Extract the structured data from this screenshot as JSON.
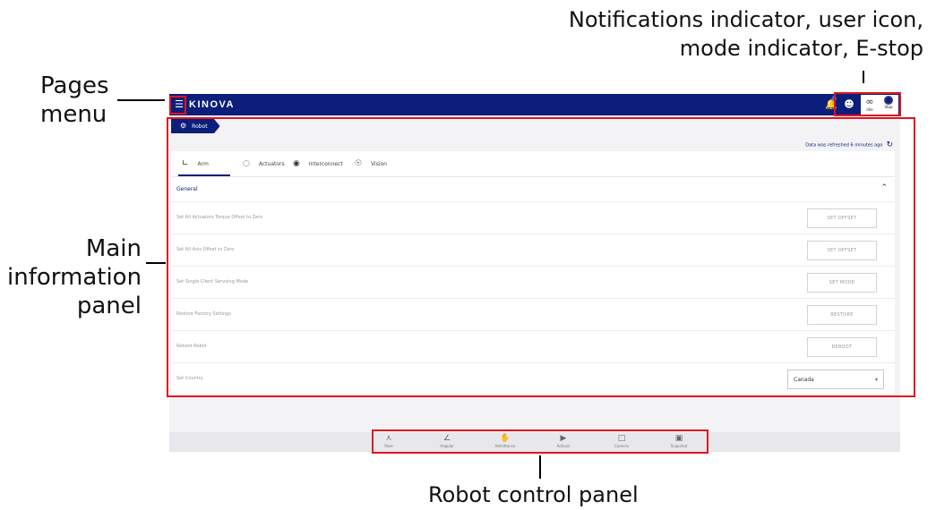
{
  "annotations": {
    "top_line1": "Notifications indicator, user icon,",
    "top_line2": "mode indicator, E-stop",
    "pages_line1": "Pages",
    "pages_line2": "menu",
    "main_line1": "Main",
    "main_line2": "information",
    "main_line3": "panel",
    "bottom": "Robot control panel"
  },
  "header": {
    "logo": "KINOVA",
    "notification_count": "1",
    "mode_label": "Idle",
    "estop_label": "Stop"
  },
  "breadcrumb": {
    "label": "Robot"
  },
  "refresh_text": "Data was refreshed 6 minutes ago",
  "tabs": [
    {
      "label": "Arm",
      "icon": "arm-icon",
      "active": true
    },
    {
      "label": "Actuators",
      "icon": "actuators-icon"
    },
    {
      "label": "Interconnect",
      "icon": "interconnect-icon"
    },
    {
      "label": "Vision",
      "icon": "vision-icon"
    }
  ],
  "section": {
    "title": "General"
  },
  "rows": [
    {
      "label": "Set All Actuators Torque Offset to Zero",
      "button": "SET OFFSET"
    },
    {
      "label": "Set All Axis Offset to Zero",
      "button": "SET OFFSET"
    },
    {
      "label": "Set Single Client Servoing Mode",
      "button": "SET MODE"
    },
    {
      "label": "Restore Factory Settings",
      "button": "RESTORE"
    },
    {
      "label": "Reboot Robot",
      "button": "REBOOT"
    },
    {
      "label": "Set Country",
      "select_value": "Canada"
    }
  ],
  "controls": [
    {
      "label": "Pose",
      "icon": "pose-icon"
    },
    {
      "label": "Angular",
      "icon": "angular-icon"
    },
    {
      "label": "Admittance",
      "icon": "admittance-icon"
    },
    {
      "label": "Actions",
      "icon": "actions-icon"
    },
    {
      "label": "Camera",
      "icon": "camera-icon"
    },
    {
      "label": "Snapshot",
      "icon": "snapshot-icon"
    }
  ],
  "colors": {
    "brand": "#0b1f7a",
    "highlight": "#e0141f"
  }
}
